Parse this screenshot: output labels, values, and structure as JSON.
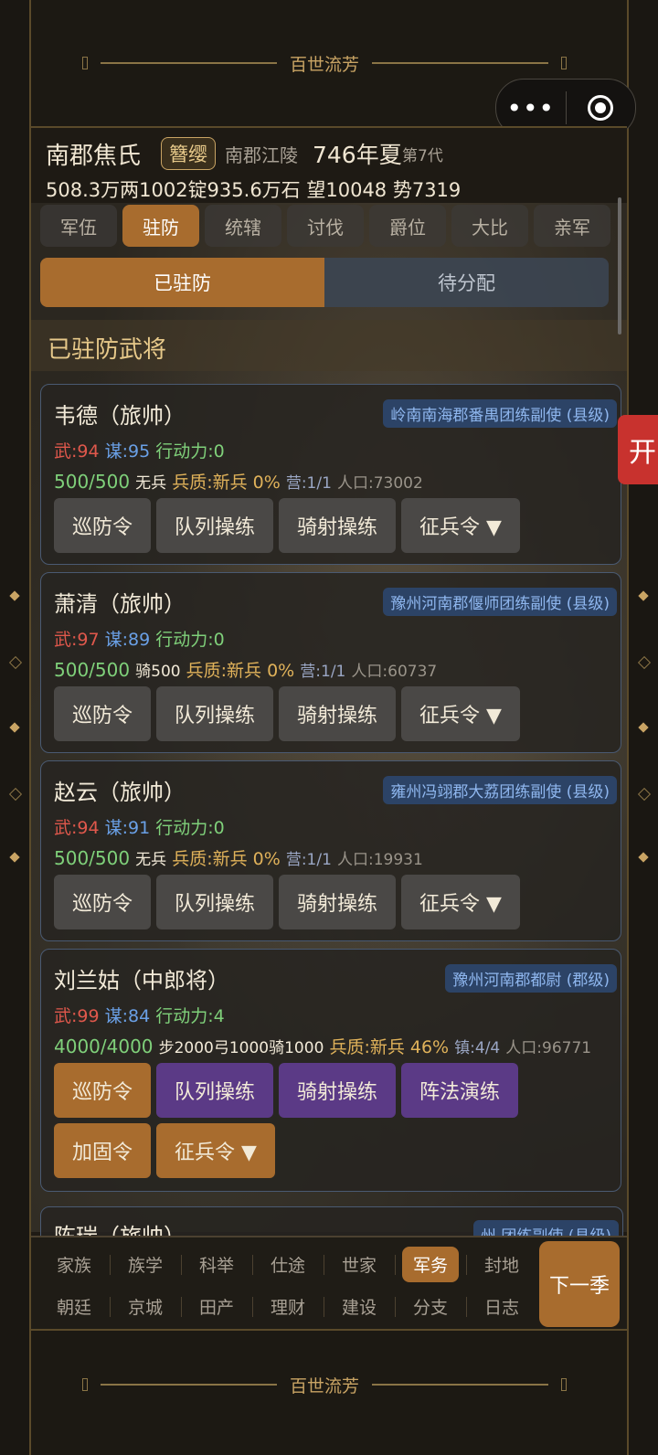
{
  "frame": {
    "top_title": "百世流芳",
    "bottom_title": "百世流芳"
  },
  "capsule": {
    "more_icon": "•••",
    "target_icon": "target-icon"
  },
  "header": {
    "clan_name": "南郡焦氏",
    "badge": "簪缨",
    "location": "南郡江陵",
    "year": "746年夏",
    "generation": "第7代",
    "stats": "508.3万两1002锭935.6万石  望10048 势7319"
  },
  "tabs": [
    "军伍",
    "驻防",
    "统辖",
    "讨伐",
    "爵位",
    "大比",
    "亲军"
  ],
  "active_tab": "驻防",
  "segment": {
    "on": "已驻防",
    "off": "待分配"
  },
  "section_title": "已驻防武将",
  "open_button": "开",
  "cards": [
    {
      "name": "韦德（旅帅）",
      "title": "岭南南海郡番禺团练副使 (县级)",
      "wu": "武:94",
      "mou": "谋:95",
      "act": "行动力:0",
      "troops": "500/500",
      "mix": "无兵",
      "quality": "兵质:新兵 0%",
      "camp": "营:1/1",
      "pop": "人口:73002",
      "buttons": [
        "巡防令",
        "队列操练",
        "骑射操练",
        "征兵令 ▼"
      ]
    },
    {
      "name": "萧清（旅帅）",
      "title": "豫州河南郡偃师团练副使 (县级)",
      "wu": "武:97",
      "mou": "谋:89",
      "act": "行动力:0",
      "troops": "500/500",
      "mix": "骑500",
      "quality": "兵质:新兵 0%",
      "camp": "营:1/1",
      "pop": "人口:60737",
      "buttons": [
        "巡防令",
        "队列操练",
        "骑射操练",
        "征兵令 ▼"
      ]
    },
    {
      "name": "赵云（旅帅）",
      "title": "雍州冯翊郡大荔团练副使 (县级)",
      "wu": "武:94",
      "mou": "谋:91",
      "act": "行动力:0",
      "troops": "500/500",
      "mix": "无兵",
      "quality": "兵质:新兵 0%",
      "camp": "营:1/1",
      "pop": "人口:19931",
      "buttons": [
        "巡防令",
        "队列操练",
        "骑射操练",
        "征兵令 ▼"
      ]
    },
    {
      "name": "刘兰姑（中郎将）",
      "title": "豫州河南郡都尉 (郡级)",
      "wu": "武:99",
      "mou": "谋:84",
      "act": "行动力:4",
      "troops": "4000/4000",
      "mix": "步2000弓1000骑1000",
      "quality": "兵质:新兵 46%",
      "camp": "镇:4/4",
      "pop": "人口:96771",
      "buttons": [
        "巡防令",
        "队列操练",
        "骑射操练",
        "阵法演练",
        "加固令",
        "征兵令 ▼"
      ]
    }
  ],
  "peek_card": {
    "name": "陈瑞（旅帅）",
    "title": "州 团练副使 (县级)"
  },
  "bottom_nav": {
    "row1": [
      "家族",
      "族学",
      "科举",
      "仕途",
      "世家",
      "军务",
      "封地"
    ],
    "row2": [
      "朝廷",
      "京城",
      "田产",
      "理财",
      "建设",
      "分支",
      "日志"
    ],
    "active": "军务",
    "next_button": "下一季"
  },
  "colors": {
    "accent": "#a86c2e",
    "purple": "#5b3a86",
    "title_blue": "#2c4366"
  }
}
